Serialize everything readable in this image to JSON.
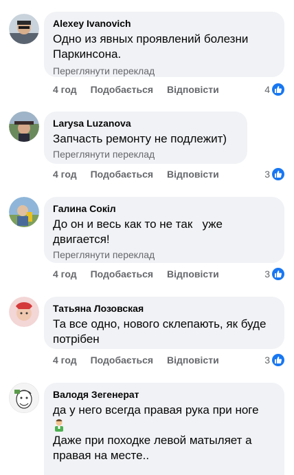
{
  "comments": [
    {
      "author": "Alexey Ivanovich",
      "text": "Одно из явных проявлений болезни Паркинсона.",
      "translate": "Переглянути переклад",
      "time": "4 год",
      "like": "Подобається",
      "reply": "Відповісти",
      "reactions": "4"
    },
    {
      "author": "Larysa Luzanova",
      "text": "Запчасть ремонту не подлежит)",
      "translate": "Переглянути переклад",
      "time": "4 год",
      "like": "Подобається",
      "reply": "Відповісти",
      "reactions": "3"
    },
    {
      "author": "Галина Сокіл",
      "text": "До он и весь как то не так   уже двигается!",
      "translate": "Переглянути переклад",
      "time": "4 год",
      "like": "Подобається",
      "reply": "Відповісти",
      "reactions": "3"
    },
    {
      "author": "Татьяна Лозовская",
      "text": "Та все одно, нового склепають, як буде потрібен",
      "time": "4 год",
      "like": "Подобається",
      "reply": "Відповісти",
      "reactions": "3"
    },
    {
      "author": "Валодя Зегенерат",
      "text_line1": " да у него всегда правая рука при ноге",
      "text_line2": "Даже при походке левой матыляет а правая на месте.."
    }
  ],
  "colors": {
    "bubble": "#f0f2f5",
    "secondary_text": "#65676b",
    "like_blue": "#1877f2"
  }
}
